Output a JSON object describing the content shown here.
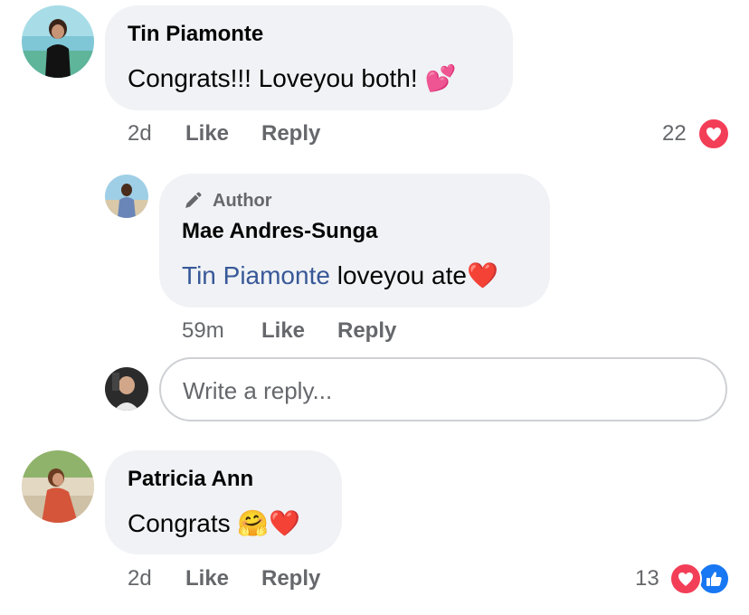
{
  "comments": [
    {
      "author": "Tin Piamonte",
      "text": "Congrats!!! Loveyou both!",
      "emoji": "💕",
      "time": "2d",
      "like": "Like",
      "reply": "Reply",
      "reaction_count": "22",
      "reactions": [
        "love-icon"
      ],
      "replies": [
        {
          "badge": "Author",
          "badge_icon": "pen-icon",
          "author": "Mae Andres-Sunga",
          "mention": "Tin Piamonte",
          "text": " loveyou ate",
          "emoji": "❤️",
          "time": "59m",
          "like": "Like",
          "reply": "Reply"
        }
      ]
    },
    {
      "author": "Patricia Ann",
      "text": "Congrats ",
      "emoji": "🤗❤️",
      "time": "2d",
      "like": "Like",
      "reply": "Reply",
      "reaction_count": "13",
      "reactions": [
        "love-icon",
        "like-icon"
      ]
    }
  ],
  "reply_input": {
    "placeholder": "Write a reply..."
  },
  "colors": {
    "bubble": "#f0f2f5",
    "secondary_text": "#65676b",
    "mention": "#385898",
    "love": "#f33e58",
    "like": "#1877f2"
  }
}
